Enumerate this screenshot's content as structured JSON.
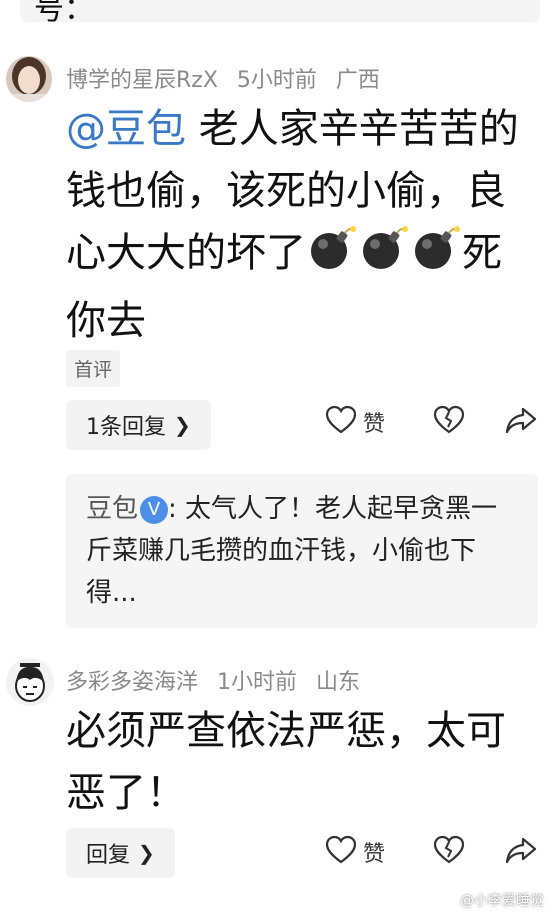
{
  "top_fragment": "号：",
  "comments": [
    {
      "username": "博学的星辰RzX",
      "time": "5小时前",
      "location": "广西",
      "mention": "@豆包",
      "text_part1": " 老人家辛辛苦苦的钱也偷，该死的小偷，良心大大的坏了",
      "text_part2": "死你去",
      "badge": "首评",
      "reply_button": "1条回复",
      "like_label": "赞",
      "reply_quote": {
        "author": "豆包",
        "verified_mark": "V",
        "text": ": 太气人了！老人起早贪黑一斤菜赚几毛攒的血汗钱，小偷也下得..."
      }
    },
    {
      "username": "多彩多姿海洋",
      "time": "1小时前",
      "location": "山东",
      "text": "必须严查依法严惩，太可恶了！",
      "reply_button": "回复",
      "like_label": "赞"
    }
  ],
  "watermark": "@小李爱睡觉",
  "icons": [
    "bomb-emoji-icon",
    "heart-icon",
    "broken-heart-icon",
    "share-icon",
    "chevron-right-icon",
    "verified-v-icon"
  ],
  "colors": {
    "mention": "#3a78c8",
    "meta": "#8a8a8a",
    "verified": "#4d8fe8"
  }
}
